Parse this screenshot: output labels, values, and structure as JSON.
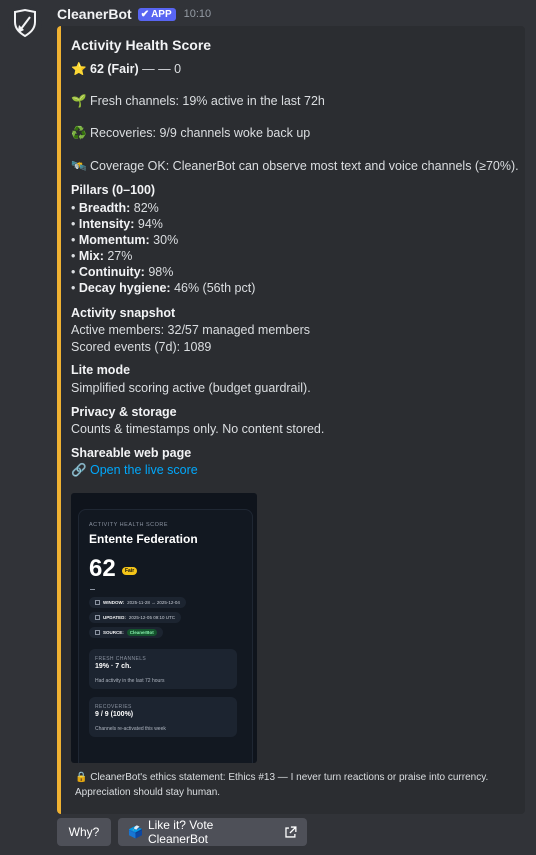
{
  "bot": {
    "name": "CleanerBot",
    "badge": "APP",
    "badge_check": "✔",
    "time": "10:10"
  },
  "embed": {
    "title": "Activity Health Score",
    "score_icon": "⭐",
    "score_label": "62 (Fair)",
    "score_trend": "— — 0",
    "fresh_icon": "🌱",
    "fresh_text": "Fresh channels: 19% active in the last 72h",
    "recover_icon": "♻️",
    "recover_text": "Recoveries: 9/9 channels woke back up",
    "coverage_icon": "🛰️",
    "coverage_text": "Coverage OK: CleanerBot can observe most text and voice channels (≥70%).",
    "pillars_title": "Pillars (0–100)",
    "pillars": [
      {
        "name": "Breadth:",
        "value": "82%"
      },
      {
        "name": "Intensity:",
        "value": "94%"
      },
      {
        "name": "Momentum:",
        "value": "30%"
      },
      {
        "name": "Mix:",
        "value": "27%"
      },
      {
        "name": "Continuity:",
        "value": "98%"
      },
      {
        "name": "Decay hygiene:",
        "value": "46% (56th pct)"
      }
    ],
    "snapshot_title": "Activity snapshot",
    "snapshot_members": "Active members: 32/57 managed members",
    "snapshot_events": "Scored events (7d): 1089",
    "lite_title": "Lite mode",
    "lite_text": "Simplified scoring active (budget guardrail).",
    "privacy_title": "Privacy & storage",
    "privacy_text": "Counts & timestamps only. No content stored.",
    "share_title": "Shareable web page",
    "share_icon": "🔗",
    "share_link": "Open the live score",
    "footer_icon": "🔒",
    "footer_text": "CleanerBot's ethics statement: Ethics #13 — I never turn reactions or praise into currency. Appreciation should stay human."
  },
  "preview": {
    "eyebrow": "ACTIVITY HEALTH SCORE",
    "name": "Entente Federation",
    "score": "62",
    "fair": "Fair",
    "window_label": "WINDOW:",
    "window_value": "2025-11-28 → 2025-12-04",
    "updated_label": "UPDATED:",
    "updated_value": "2025-12-05 09:10 UTC",
    "source_label": "SOURCE:",
    "source_value": "CleanerBot",
    "fresh_label": "FRESH CHANNELS",
    "fresh_value": "19% · 7 ch.",
    "fresh_desc": "Had activity in the last 72 hours",
    "recov_label": "RECOVERIES",
    "recov_value": "9 / 9 (100%)",
    "recov_desc": "Channels re-activated this week"
  },
  "buttons": {
    "why": "Why?",
    "vote_icon": "🗳️",
    "vote": "Like it? Vote CleanerBot"
  },
  "colors": {
    "accent": "#f0b232",
    "badge": "#5865f2",
    "link": "#00a8fc"
  }
}
